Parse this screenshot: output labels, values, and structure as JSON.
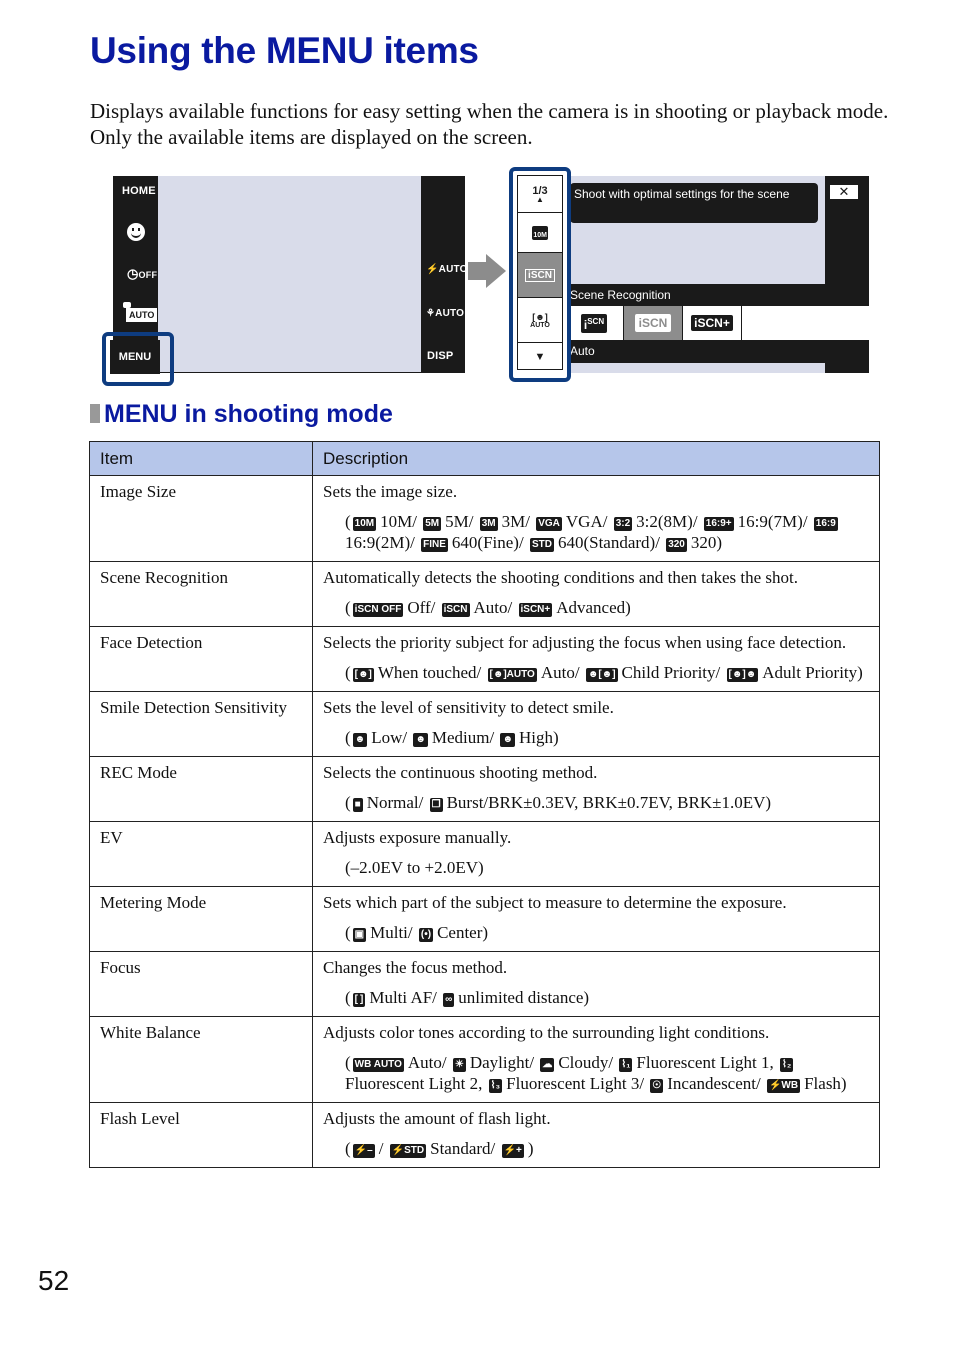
{
  "page": {
    "title": "Using the MENU items",
    "intro": "Displays available functions for easy setting when the camera is in shooting or playback mode. Only the available items are displayed on the screen.",
    "page_number": "52"
  },
  "screen1": {
    "left_buttons": [
      "HOME",
      "smile-shutter",
      "OFF",
      "AUTO",
      "MENU"
    ],
    "home_label": "HOME",
    "selftimer_label": "ᴏ OFF",
    "selftimer_text": "OFF",
    "auto_label": "AUTO",
    "menu_label": "MENU",
    "flash_label": "⚡AUTO",
    "flash_text": "AUTO",
    "macro_text": "AUTO",
    "disp_label": "DISP"
  },
  "screen2": {
    "page_indicator": "1/3",
    "side_items": [
      "10M",
      "iSCN",
      "AUTO"
    ],
    "tooltip": "Shoot with optimal settings for the scene",
    "close_label": "✕",
    "scene_label": "Scene Recognition",
    "options": [
      "iSCN OFF",
      "iSCN",
      "iSCN+"
    ],
    "selected_option": "Auto",
    "colors": {
      "highlight_border": "#0e3c80",
      "screen_bg": "#d9dcea",
      "dark": "#1a1a1a",
      "selected": "#8d8d8d"
    }
  },
  "section": {
    "title": "MENU in shooting mode"
  },
  "table": {
    "headers": {
      "item": "Item",
      "description": "Description"
    },
    "header_bg": "#b6c6ea",
    "rows": [
      {
        "item": "Image Size",
        "desc": "Sets the image size.",
        "options": [
          {
            "icon": "10M",
            "label": "10M/"
          },
          {
            "icon": "5M",
            "label": "5M/"
          },
          {
            "icon": "3M",
            "label": "3M/"
          },
          {
            "icon": "VGA",
            "label": "VGA/"
          },
          {
            "icon": "3:2",
            "label": "3:2(8M)/"
          },
          {
            "icon": "16:9+",
            "label": "16:9(7M)/"
          },
          {
            "icon": "16:9",
            "label": "16:9(2M)/"
          },
          {
            "icon": "FINE",
            "label": "640(Fine)/"
          },
          {
            "icon": "STD",
            "label": "640(Standard)/"
          },
          {
            "icon": "320",
            "label": "320)"
          }
        ]
      },
      {
        "item": "Scene Recognition",
        "desc": "Automatically detects the shooting conditions and then takes the shot.",
        "options": [
          {
            "icon": "iSCN OFF",
            "label": "Off/"
          },
          {
            "icon": "iSCN",
            "label": "Auto/"
          },
          {
            "icon": "iSCN+",
            "label": "Advanced)"
          }
        ]
      },
      {
        "item": "Face Detection",
        "desc": "Selects the priority subject for adjusting the focus when using face detection.",
        "options": [
          {
            "icon": "[☻]",
            "label": "When touched/"
          },
          {
            "icon": "[☻]AUTO",
            "label": "Auto/"
          },
          {
            "icon": "☻[☻]",
            "label": "Child Priority/"
          },
          {
            "icon": "[☻]☻",
            "label": "Adult Priority)"
          }
        ]
      },
      {
        "item": "Smile Detection Sensitivity",
        "desc": "Sets the level of sensitivity to detect smile.",
        "options": [
          {
            "icon": "☻",
            "label": "Low/"
          },
          {
            "icon": "☻",
            "label": "Medium/"
          },
          {
            "icon": "☻",
            "label": "High)"
          }
        ]
      },
      {
        "item": "REC Mode",
        "desc": "Selects the continuous shooting method.",
        "options": [
          {
            "icon": "■",
            "label": "Normal/"
          },
          {
            "icon": "❐",
            "label": "Burst/BRK±0.3EV, BRK±0.7EV, BRK±1.0EV)"
          }
        ]
      },
      {
        "item": "EV",
        "desc": "Adjusts exposure manually.",
        "options_text": "(–2.0EV to +2.0EV)"
      },
      {
        "item": "Metering Mode",
        "desc": "Sets which part of the subject to measure to determine the exposure.",
        "options": [
          {
            "icon": "▣",
            "label": "Multi/"
          },
          {
            "icon": "(•)",
            "label": "Center)"
          }
        ]
      },
      {
        "item": "Focus",
        "desc": "Changes the focus method.",
        "options": [
          {
            "icon": "[ ]",
            "label": "Multi AF/"
          },
          {
            "icon": "∞",
            "label": "unlimited distance)"
          }
        ]
      },
      {
        "item": "White Balance",
        "desc": "Adjusts color tones according to the surrounding light conditions.",
        "options": [
          {
            "icon": "WB AUTO",
            "label": "Auto/"
          },
          {
            "icon": "☀",
            "label": "Daylight/"
          },
          {
            "icon": "☁",
            "label": "Cloudy/"
          },
          {
            "icon": "⌇₁",
            "label": "Fluorescent Light 1,"
          },
          {
            "icon": "⌇₂",
            "label": "Fluorescent Light 2,"
          },
          {
            "icon": "⌇₃",
            "label": "Fluorescent Light 3/"
          },
          {
            "icon": "☉",
            "label": "Incandescent/"
          },
          {
            "icon": "⚡WB",
            "label": "Flash)"
          }
        ]
      },
      {
        "item": "Flash Level",
        "desc": "Adjusts the amount of flash light.",
        "options": [
          {
            "icon": "⚡–",
            "label": "/"
          },
          {
            "icon": "⚡STD",
            "label": "Standard/"
          },
          {
            "icon": "⚡+",
            "label": ")"
          }
        ]
      }
    ]
  }
}
